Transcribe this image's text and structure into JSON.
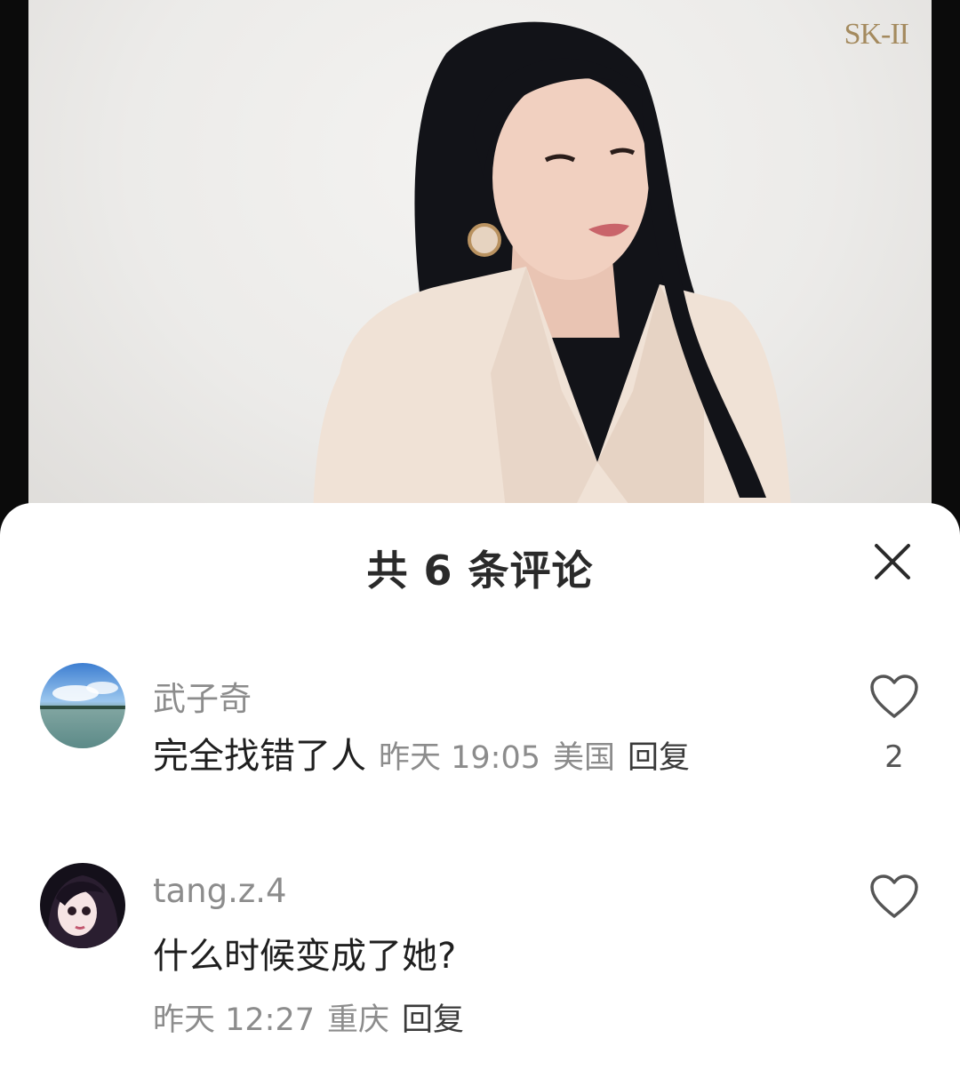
{
  "video": {
    "brand_logo_text": "SK-II",
    "colors": {
      "background": "#ecebe9",
      "blazer": "#f0e2d6",
      "hair": "#121318",
      "brand": "#a48a5e"
    }
  },
  "comments_panel": {
    "title": "共 6 条评论",
    "close_icon": "close-icon",
    "comments": [
      {
        "username": "武子奇",
        "text": "完全找错了人",
        "time": "昨天 19:05",
        "location": "美国",
        "reply_label": "回复",
        "like_icon": "heart-outline-icon",
        "like_count": "2"
      },
      {
        "username": "tang.z.4",
        "text": "什么时候变成了她?",
        "time": "昨天 12:27",
        "location": "重庆",
        "reply_label": "回复",
        "like_icon": "heart-outline-icon"
      }
    ]
  }
}
